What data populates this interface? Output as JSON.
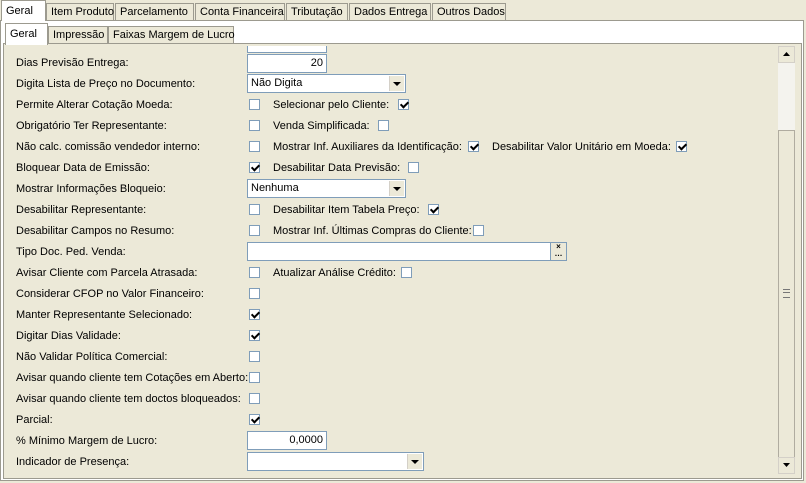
{
  "tabs_top": [
    "Geral",
    "Item Produto",
    "Parcelamento",
    "Conta Financeira",
    "Tributação",
    "Dados Entrega",
    "Outros Dados"
  ],
  "tabs_sub": [
    "Geral",
    "Impressão",
    "Faixas Margem de Lucro"
  ],
  "fields": {
    "dias_previsao_entrega": {
      "label": "Dias Previsão Entrega:",
      "value": "20"
    },
    "digita_lista_preco": {
      "label": "Digita Lista de Preço no Documento:",
      "value": "Não Digita"
    },
    "permite_alterar_cotacao": {
      "label": "Permite Alterar Cotação Moeda:",
      "checked": false
    },
    "selecionar_pelo_cliente": {
      "label": "Selecionar pelo Cliente:",
      "checked": true
    },
    "obrigatorio_representante": {
      "label": "Obrigatório Ter Representante:",
      "checked": false
    },
    "venda_simplificada": {
      "label": "Venda Simplificada:",
      "checked": false
    },
    "nao_calc_comissao": {
      "label": "Não calc. comissão vendedor interno:",
      "checked": false
    },
    "mostrar_inf_auxiliares": {
      "label": "Mostrar Inf. Auxiliares da Identificação:",
      "checked": true
    },
    "desabilitar_valor_unitario": {
      "label": "Desabilitar Valor Unitário em Moeda:",
      "checked": true
    },
    "bloquear_data_emissao": {
      "label": "Bloquear Data de Emissão:",
      "checked": true
    },
    "desabilitar_data_previsao": {
      "label": "Desabilitar Data Previsão:",
      "checked": false
    },
    "mostrar_info_bloqueio": {
      "label": "Mostrar Informações Bloqueio:",
      "value": "Nenhuma"
    },
    "desabilitar_representante": {
      "label": "Desabilitar Representante:",
      "checked": false
    },
    "desabilitar_item_tabela": {
      "label": "Desabilitar Item Tabela Preço:",
      "checked": true
    },
    "desabilitar_campos_resumo": {
      "label": "Desabilitar Campos no Resumo:",
      "checked": false
    },
    "mostrar_ultimas_compras": {
      "label": "Mostrar Inf. Últimas Compras do Cliente:",
      "checked": false
    },
    "tipo_doc_ped_venda": {
      "label": "Tipo Doc. Ped. Venda:",
      "value": ""
    },
    "avisar_parcela_atrasada": {
      "label": "Avisar Cliente com Parcela Atrasada:",
      "checked": false
    },
    "atualizar_analise_credito": {
      "label": "Atualizar Análise Crédito:",
      "checked": false
    },
    "considerar_cfop": {
      "label": "Considerar CFOP no Valor Financeiro:",
      "checked": false
    },
    "manter_representante": {
      "label": "Manter Representante Selecionado:",
      "checked": true
    },
    "digitar_dias_validade": {
      "label": "Digitar Dias Validade:",
      "checked": true
    },
    "nao_validar_politica": {
      "label": "Não Validar Política Comercial:",
      "checked": false
    },
    "avisar_cotacoes_aberto": {
      "label": "Avisar quando cliente tem Cotações em Aberto:",
      "checked": false
    },
    "avisar_doctos_bloqueados": {
      "label": "Avisar quando cliente tem doctos bloqueados:",
      "checked": false
    },
    "parcial": {
      "label": "Parcial:",
      "checked": true
    },
    "minimo_margem_lucro": {
      "label": "% Mínimo Margem de Lucro:",
      "value": "0,0000"
    },
    "indicador_presenca": {
      "label": "Indicador de Presença:",
      "value": ""
    }
  }
}
